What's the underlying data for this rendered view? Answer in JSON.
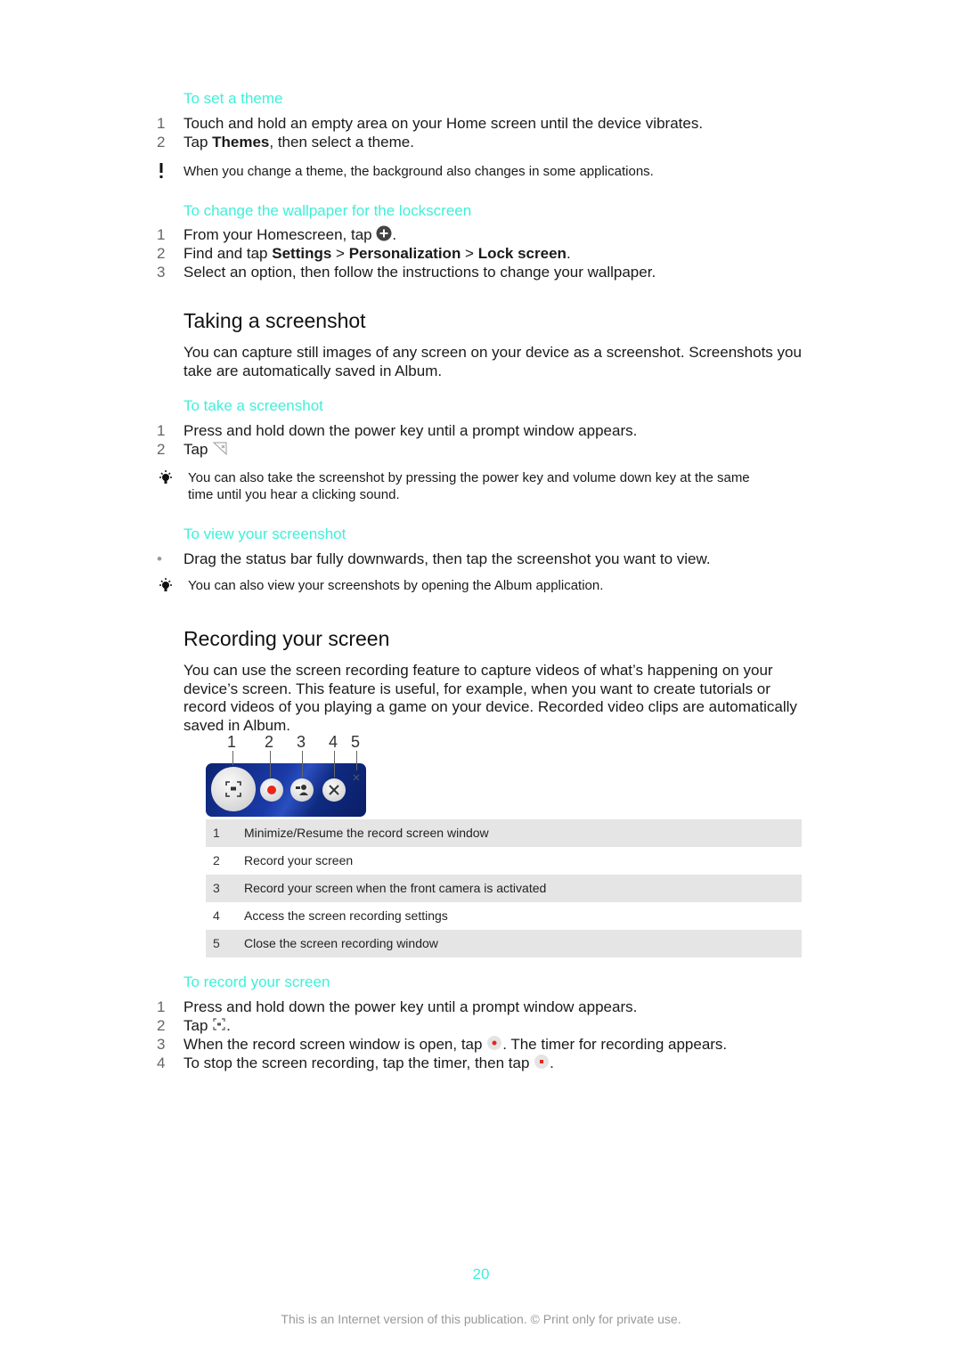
{
  "section_theme": {
    "heading": "To set a theme",
    "steps": [
      {
        "num": "1",
        "text": "Touch and hold an empty area on your Home screen until the device vibrates."
      },
      {
        "num": "2",
        "pre": "Tap ",
        "bold": "Themes",
        "post": ", then select a theme."
      }
    ],
    "note_icon": "exclamation-icon",
    "note": "When you change a theme, the background also changes in some applications."
  },
  "section_wallpaper": {
    "heading": "To change the wallpaper for the lockscreen",
    "step1": {
      "num": "1",
      "pre": "From your Homescreen, tap ",
      "icon": "app-screen-icon",
      "post": "."
    },
    "step2": {
      "num": "2",
      "pre": "Find and tap ",
      "b1": "Settings",
      "sep1": " > ",
      "b2": "Personalization",
      "sep2": " > ",
      "b3": "Lock screen",
      "post": "."
    },
    "step3": {
      "num": "3",
      "text": "Select an option, then follow the instructions to change your wallpaper."
    }
  },
  "screenshot": {
    "title": "Taking a screenshot",
    "intro": "You can capture still images of any screen on your device as a screenshot. Screenshots you take are automatically saved in Album.",
    "take_heading": "To take a screenshot",
    "take_step1": {
      "num": "1",
      "text": "Press and hold down the power key until a prompt window appears."
    },
    "take_step2": {
      "num": "2",
      "pre": "Tap ",
      "icon": "screenshot-icon"
    },
    "tip1": "You can also take the screenshot by pressing the power key and volume down key at the same time until you hear a clicking sound.",
    "view_heading": "To view your screenshot",
    "view_bullet": "•",
    "view_step": "Drag the status bar fully downwards, then tap the screenshot you want to view.",
    "tip2": "You can also view your screenshots by opening the Album application."
  },
  "recording": {
    "title": "Recording your screen",
    "intro": "You can use the screen recording feature to capture videos of what’s happening on your device’s screen. This feature is useful, for example, when you want to create tutorials or record videos of you playing a game on your device. Recorded video clips are automatically saved in Album.",
    "callouts": [
      "1",
      "2",
      "3",
      "4",
      "5"
    ],
    "legend": [
      {
        "num": "1",
        "text": "Minimize/Resume the record screen window"
      },
      {
        "num": "2",
        "text": "Record your screen"
      },
      {
        "num": "3",
        "text": "Record your screen when the front camera is activated"
      },
      {
        "num": "4",
        "text": "Access the screen recording settings"
      },
      {
        "num": "5",
        "text": "Close the screen recording window"
      }
    ],
    "record_heading": "To record your screen",
    "rec_step1": {
      "num": "1",
      "text": "Press and hold down the power key until a prompt window appears."
    },
    "rec_step2": {
      "num": "2",
      "pre": "Tap ",
      "post": "."
    },
    "rec_step3": {
      "num": "3",
      "pre": "When the record screen window is open, tap ",
      "post": ". The timer for recording appears."
    },
    "rec_step4": {
      "num": "4",
      "pre": "To stop the screen recording, tap the timer, then tap ",
      "post": "."
    }
  },
  "footer": {
    "page_number": "20",
    "notice": "This is an Internet version of this publication. © Print only for private use."
  },
  "colors": {
    "heading_accent": "#3ff0d8",
    "record_red": "#e8261c",
    "panel_blue": "#0f2a80"
  }
}
